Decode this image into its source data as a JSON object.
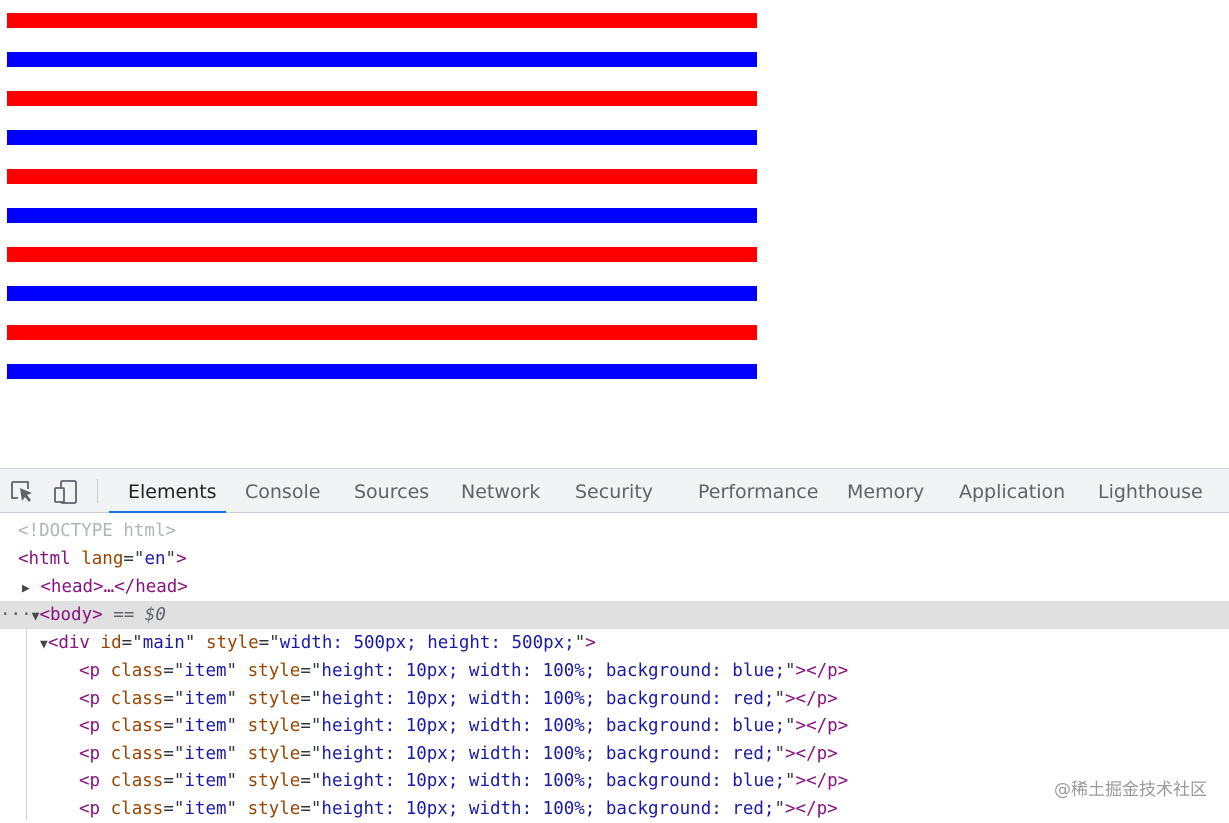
{
  "page": {
    "stripes": [
      {
        "color": "#ff0000"
      },
      {
        "color": "#0000ff"
      },
      {
        "color": "#ff0000"
      },
      {
        "color": "#0000ff"
      },
      {
        "color": "#ff0000"
      },
      {
        "color": "#0000ff"
      },
      {
        "color": "#ff0000"
      },
      {
        "color": "#0000ff"
      },
      {
        "color": "#ff0000"
      },
      {
        "color": "#0000ff"
      }
    ]
  },
  "devtools": {
    "toolbar": {
      "inspect_icon": "element-picker-icon",
      "device_icon": "device-toggle-icon",
      "tabs": [
        "Elements",
        "Console",
        "Sources",
        "Network",
        "Security",
        "Performance",
        "Memory",
        "Application",
        "Lighthouse"
      ],
      "active_tab": "Elements"
    },
    "dom": {
      "doctype": "<!DOCTYPE html>",
      "html_open": "<html",
      "html_attr": "lang",
      "html_attr_val": "en",
      "head_collapsed": "<head>…</head>",
      "body_tag": "<body>",
      "selected_marker": "== $0",
      "div_tag": "<div",
      "div_id_attr": "id",
      "div_id_val": "main",
      "div_style_attr": "style",
      "div_style_val": "width: 500px; height: 500px;",
      "p_items": [
        {
          "class": "item",
          "style": "height: 10px; width: 100%; background: blue;"
        },
        {
          "class": "item",
          "style": "height: 10px; width: 100%; background: red;"
        },
        {
          "class": "item",
          "style": "height: 10px; width: 100%; background: blue;"
        },
        {
          "class": "item",
          "style": "height: 10px; width: 100%; background: red;"
        },
        {
          "class": "item",
          "style": "height: 10px; width: 100%; background: blue;"
        },
        {
          "class": "item",
          "style": "height: 10px; width: 100%; background: red;"
        }
      ]
    }
  },
  "watermark": "@稀土掘金技术社区"
}
